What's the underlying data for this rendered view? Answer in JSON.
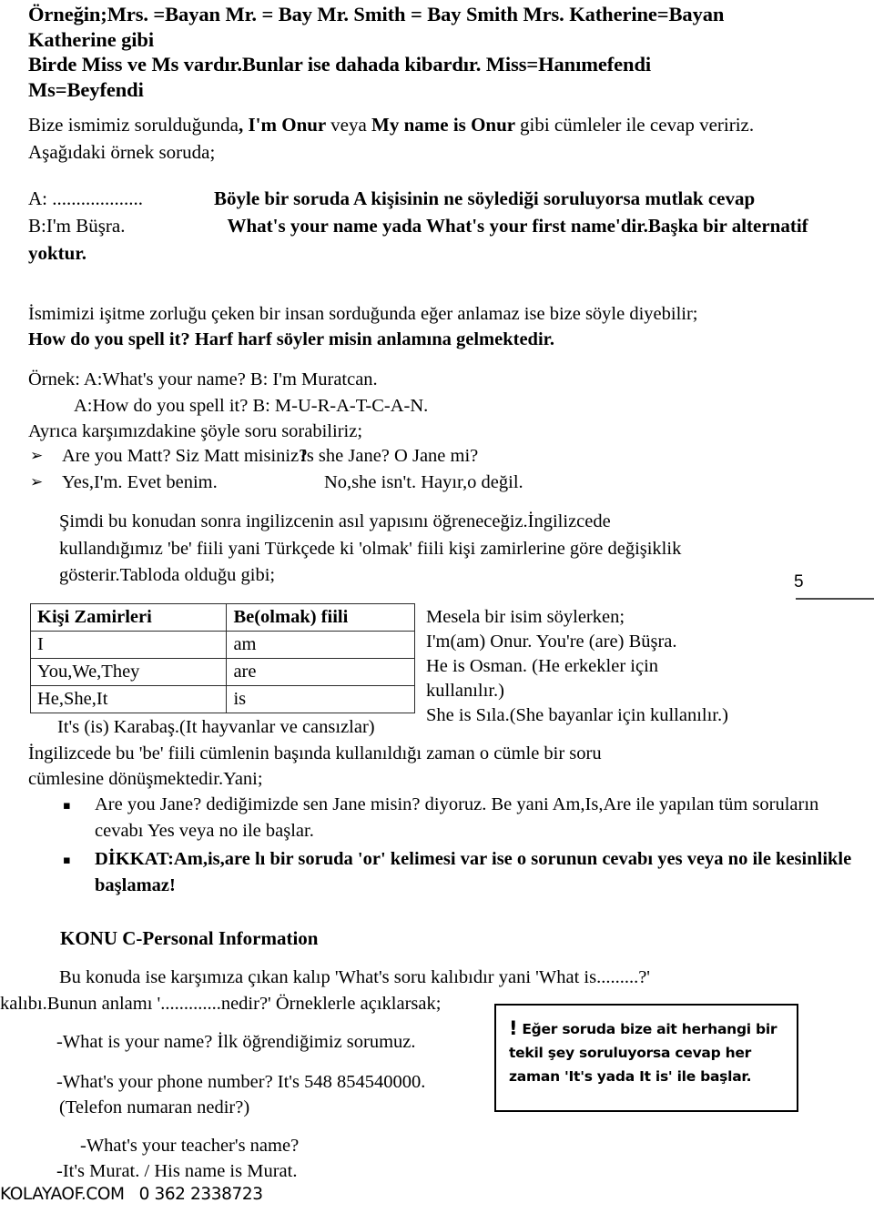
{
  "document": {
    "page_number": "5",
    "footer": {
      "site": "KOLAYAOF.COM",
      "phone": "0 362 2338723"
    }
  },
  "top_heading": {
    "line1": "Örneğin;Mrs. =Bayan   Mr. = Bay   Mr. Smith = Bay Smith   Mrs. Katherine=Bayan",
    "line2": "Katherine gibi",
    "line3": "Birde Miss ve Ms vardır.Bunlar ise dahada kibardır. Miss=Hanımefendi",
    "line4": "Ms=Beyfendi"
  },
  "intro": {
    "part1": "Bize ismimiz sorulduğunda",
    "bold1": ", I'm Onur ",
    "part2": "veya ",
    "bold2": "My name is Onur ",
    "part3": "gibi cümleler ile cevap veririz.",
    "line2": "Aşağıdaki örnek soruda;"
  },
  "dialogue": {
    "a_label": "A: ...................",
    "a_bold": "Böyle bir soruda A kişisinin ne söylediği soruluyorsa mutlak cevap",
    "b_label": "B:I'm Büşra.",
    "b_bold": "What's your name yada What's your first name'dir.Başka bir alternatif yoktur."
  },
  "spelling": {
    "line1": "İsmimizi işitme zorluğu çeken bir insan sorduğunda eğer anlamaz ise bize söyle diyebilir;",
    "line2_bold": "How do you spell it? Harf harf söyler misin anlamına gelmektedir."
  },
  "example": {
    "line1": "Örnek: A:What's your name?  B: I'm Muratcan.",
    "line2": "A:How do you spell it?  B: M-U-R-A-T-C-A-N.",
    "line3": "Ayrıca karşımızdakine şöyle soru sorabiliriz;"
  },
  "arrow_list": {
    "marker": "arrow-bullet-icon",
    "glyph": "➢",
    "rows": [
      {
        "left": "Are you Matt? Siz Matt misiniz?",
        "right": "Is she Jane?  O Jane mi?"
      },
      {
        "left": "Yes,I'm.   Evet benim.",
        "right": "No,she isn't.  Hayır,o değil."
      }
    ]
  },
  "be_intro": {
    "line1": "Şimdi bu konudan sonra ingilizcenin asıl yapısını öğreneceğiz.İngilizcede",
    "line2": "kullandığımız 'be' fiili yani Türkçede ki 'olmak' fiili kişi zamirlerine göre değişiklik",
    "line3": "gösterir.Tabloda olduğu gibi;"
  },
  "pronoun_table": {
    "headers": [
      "Kişi Zamirleri",
      "Be(olmak) fiili"
    ],
    "rows": [
      [
        "I",
        "am"
      ],
      [
        "You,We,They",
        "are"
      ],
      [
        "He,She,It",
        "is"
      ]
    ]
  },
  "side_note": {
    "line1": "Mesela bir isim söylerken;",
    "line2": "I'm(am) Onur.   You're (are) Büşra.",
    "line3": "He is Osman. (He erkekler için",
    "line4": "kullanılır.)",
    "line5": "She is Sıla.(She bayanlar için kullanılır.)"
  },
  "after_table": {
    "line1": "It's (is) Karabaş.(It hayvanlar ve cansızlar)",
    "line2": "İngilizcede bu 'be' fiili cümlenin başında kullanıldığı zaman o cümle bir soru",
    "line3": "cümlesine dönüşmektedir.Yani;"
  },
  "square_list": {
    "marker": "square-bullet-icon",
    "glyph": "▪",
    "items": [
      {
        "text": "Are you Jane? dediğimizde sen  Jane misin? diyoruz. Be yani Am,Is,Are ile yapılan tüm soruların cevabı Yes veya no ile başlar.",
        "bold": false
      },
      {
        "text": "DİKKAT:Am,is,are lı bir soruda 'or' kelimesi var ise  o sorunun cevabı yes veya no ile kesinlikle başlamaz!",
        "bold": true
      }
    ]
  },
  "konu_c": {
    "heading": "KONU C-Personal Information",
    "line1": "Bu konuda ise karşımıza çıkan kalıp 'What's soru kalıbıdır yani 'What is.........?'",
    "line2": "kalıbı.Bunun anlamı '.............nedir?' Örneklerle açıklarsak;"
  },
  "qa": {
    "q1": "-What is your name? İlk öğrendiğimiz sorumuz.",
    "q2_line1": "-What's your phone number?   It's  548 854540000.",
    "q2_line2": "(Telefon numaran nedir?)",
    "q3_line1": "-What's your  teacher's name?",
    "q3_line2": "-It's Murat. / His name is Murat."
  },
  "callout": {
    "icon": "exclamation-icon",
    "glyph": "!",
    "text": "Eğer soruda bize ait herhangi bir tekil şey soruluyorsa cevap her zaman 'It's yada It is' ile başlar."
  }
}
